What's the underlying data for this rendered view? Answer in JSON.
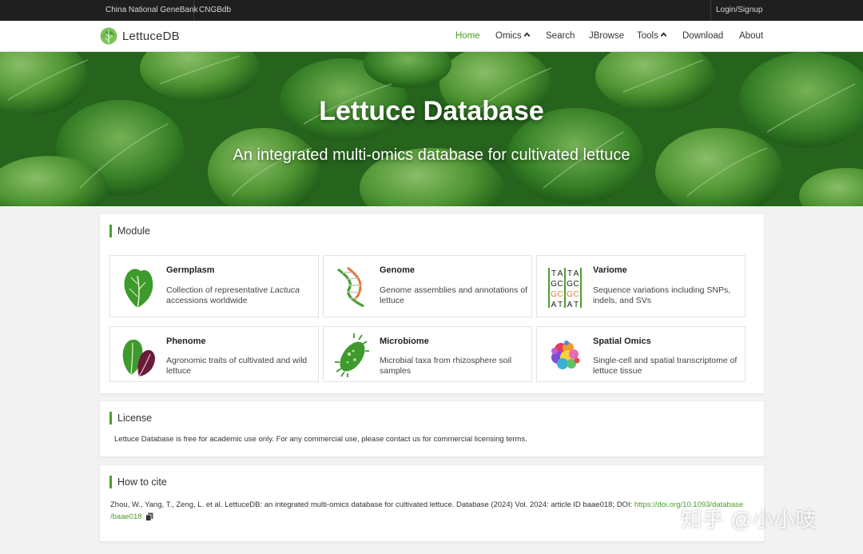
{
  "topbar": {
    "genebank": "China National GeneBank",
    "cngbdb": "CNGBdb",
    "login": "Login/Signup"
  },
  "brand": {
    "name": "LettuceDB"
  },
  "nav": {
    "home": "Home",
    "omics": "Omics",
    "search": "Search",
    "jbrowse": "JBrowse",
    "tools": "Tools",
    "download": "Download",
    "about": "About"
  },
  "hero": {
    "title": "Lettuce Database",
    "subtitle": "An integrated multi-omics database for cultivated lettuce"
  },
  "module": {
    "heading": "Module",
    "cards": [
      {
        "title": "Germplasm",
        "desc_before": "Collection of representative ",
        "desc_italic": "Lactuca",
        "desc_after": " accessions worldwide",
        "icon": "lettuce-plant-icon"
      },
      {
        "title": "Genome",
        "desc": "Genome assemblies and annotations of lettuce",
        "icon": "dna-helix-icon"
      },
      {
        "title": "Variome",
        "desc": "Sequence variations including SNPs, indels, and SVs",
        "icon": "sequence-alignment-icon"
      },
      {
        "title": "Phenome",
        "desc": "Agronomic traits of cultivated and wild lettuce",
        "icon": "lettuce-leaves-icon"
      },
      {
        "title": "Microbiome",
        "desc": "Microbial taxa from rhizosphere soil samples",
        "icon": "microbe-icon"
      },
      {
        "title": "Spatial Omics",
        "desc": "Single-cell and spatial transcriptome of lettuce tissue",
        "icon": "cell-cluster-icon"
      }
    ],
    "variome_letters": [
      [
        "T",
        "A",
        "T",
        "A"
      ],
      [
        "G",
        "C",
        "G",
        "C"
      ],
      [
        "G",
        "C",
        "G",
        "C"
      ],
      [
        "A",
        "T",
        "A",
        "T"
      ]
    ]
  },
  "license": {
    "heading": "License",
    "text": "Lettuce Database is free for academic use only. For any commercial use, please contact us for commercial licensing terms."
  },
  "cite": {
    "heading": "How to cite",
    "text": "Zhou, W., Yang, T., Zeng, L. et al. LettuceDB: an integrated multi-omics database for cultivated lettuce. Database (2024) Vol. 2024: article ID baae018; DOI: ",
    "doi_part1": "https://doi.org/10.1093/database",
    "doi_part2": "/baae018"
  },
  "watermark": "知乎 @小小吱",
  "colors": {
    "accent": "#4aa02c",
    "topbar": "#1f1f1f"
  }
}
